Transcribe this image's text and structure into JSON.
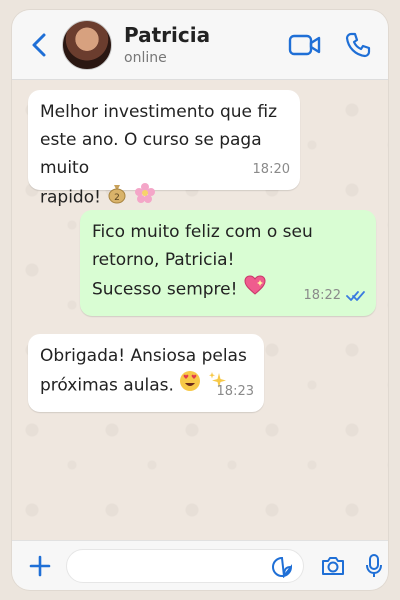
{
  "header": {
    "contact_name": "Patricia",
    "contact_status": "online"
  },
  "colors": {
    "accent": "#1f6fd6",
    "incoming_bubble": "#ffffff",
    "outgoing_bubble": "#d9fdd3",
    "chat_background": "#efe7df",
    "read_ticks": "#3a7be0"
  },
  "messages": [
    {
      "direction": "incoming",
      "text": "Melhor investimento que fiz\neste ano. O curso se paga muito\nrapido!",
      "emojis": [
        "money-bag",
        "cherry-blossom"
      ],
      "time": "18:20"
    },
    {
      "direction": "outgoing",
      "text": "Fico muito feliz com o seu\nretorno, Patricia!\nSucesso sempre!",
      "emojis": [
        "sparkling-heart"
      ],
      "time": "18:22",
      "read_receipt": "double-check"
    },
    {
      "direction": "incoming",
      "text": "Obrigada! Ansiosa pelas\npróximas aulas.",
      "emojis": [
        "heart-eyes",
        "sparkles"
      ],
      "time": "18:23"
    }
  ],
  "input": {
    "placeholder": "",
    "value": ""
  },
  "icons": {
    "back": "chevron-left-icon",
    "video_call": "video-camera-icon",
    "voice_call": "phone-icon",
    "attach": "plus-icon",
    "sticker": "sticker-icon",
    "camera": "camera-icon",
    "microphone": "microphone-icon"
  }
}
